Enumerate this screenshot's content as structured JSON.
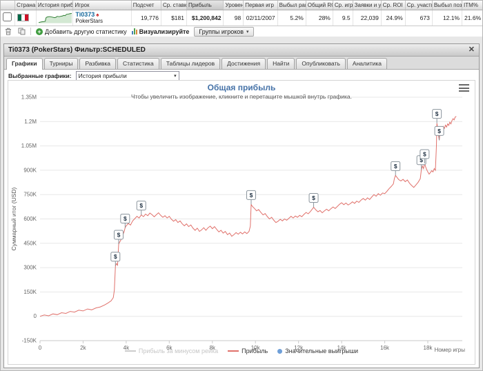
{
  "results_table": {
    "headers": [
      "",
      "Страна",
      "История прибыл",
      "Игрок",
      "Подсчет",
      "Ср. ставк",
      "Прибыль",
      "Уровень",
      "Первая игр",
      "Выбыл ранс",
      "Общий RO",
      "Ср. игр",
      "Заявки и у",
      "Ср. ROI",
      "Ср. участи",
      "Выбыл поздно",
      "ITM%"
    ],
    "row": {
      "country": "Mexico",
      "player": "Ti0373",
      "network": "PokerStars",
      "values": [
        "19,776",
        "$181",
        "$1,200,842",
        "98",
        "02/11/2007",
        "5.2%",
        "28%",
        "9.5",
        "22,039",
        "24.9%",
        "673",
        "12.1%",
        "21.6%"
      ]
    }
  },
  "toolbar": {
    "add_statistic": "Добавить другую статистику",
    "visualize": "Визуализируйте",
    "player_groups": "Группы игроков"
  },
  "panel": {
    "title": "Ti0373 (PokerStars) Фильтр:SCHEDULED",
    "tabs": [
      "Графики",
      "Турниры",
      "Разбивка",
      "Статистика",
      "Таблицы лидеров",
      "Достижения",
      "Найти",
      "Опубликовать",
      "Аналитика"
    ],
    "active_tab": "Графики",
    "selected_graphs_label": "Выбранные графики:",
    "selected_graph": "История прибыли"
  },
  "colors": {
    "accent_blue": "#4572a7",
    "profit_line": "#e0706a",
    "wins_blue": "#6f9fd8",
    "disabled_legend": "#cccccc"
  },
  "chart_data": {
    "type": "line",
    "title": "Общая прибыль",
    "subtitle": "Чтобы увеличить изображение, кликните и перетащите мышкой внутрь графика.",
    "xlabel": "Номер игры",
    "ylabel": "Суммарный итог (USD)",
    "xlim": [
      0,
      19600
    ],
    "ylim": [
      -150000,
      1350000
    ],
    "grid": "horizontal",
    "legend_position": "bottom",
    "flag_label": "$",
    "xticks": {
      "values": [
        0,
        2000,
        4000,
        6000,
        8000,
        10000,
        12000,
        14000,
        16000,
        18000
      ],
      "labels": [
        "0",
        "2k",
        "4k",
        "6k",
        "8k",
        "10k",
        "12k",
        "14k",
        "16k",
        "18k"
      ]
    },
    "yticks": {
      "values": [
        -150000,
        0,
        150000,
        300000,
        450000,
        600000,
        750000,
        900000,
        1050000,
        1200000,
        1350000
      ],
      "labels": [
        "-150K",
        "0",
        "150K",
        "300K",
        "450K",
        "600K",
        "750K",
        "900K",
        "1.05M",
        "1.2M",
        "1.35M"
      ]
    },
    "series": [
      {
        "name": "Прибыль за минусом рейка",
        "color": "#cccccc",
        "visible": false,
        "points": []
      },
      {
        "name": "Прибыль",
        "color": "#e0706a",
        "visible": true,
        "points": [
          [
            0,
            0
          ],
          [
            200,
            8000
          ],
          [
            400,
            3000
          ],
          [
            600,
            15000
          ],
          [
            800,
            10000
          ],
          [
            1000,
            22000
          ],
          [
            1200,
            18000
          ],
          [
            1400,
            30000
          ],
          [
            1600,
            26000
          ],
          [
            1800,
            38000
          ],
          [
            2000,
            33000
          ],
          [
            2200,
            45000
          ],
          [
            2400,
            40000
          ],
          [
            2600,
            52000
          ],
          [
            2800,
            58000
          ],
          [
            3000,
            70000
          ],
          [
            3150,
            82000
          ],
          [
            3300,
            95000
          ],
          [
            3400,
            115000
          ],
          [
            3450,
            160000
          ],
          [
            3500,
            310000
          ],
          [
            3550,
            325000
          ],
          [
            3600,
            315000
          ],
          [
            3650,
            445000
          ],
          [
            3700,
            458000
          ],
          [
            3750,
            470000
          ],
          [
            3800,
            488000
          ],
          [
            3850,
            505000
          ],
          [
            3900,
            520000
          ],
          [
            3950,
            545000
          ],
          [
            4000,
            558000
          ],
          [
            4100,
            572000
          ],
          [
            4200,
            562000
          ],
          [
            4300,
            588000
          ],
          [
            4400,
            602000
          ],
          [
            4500,
            616000
          ],
          [
            4600,
            606000
          ],
          [
            4700,
            625000
          ],
          [
            4800,
            614000
          ],
          [
            4900,
            630000
          ],
          [
            5000,
            620000
          ],
          [
            5100,
            636000
          ],
          [
            5200,
            626000
          ],
          [
            5300,
            613000
          ],
          [
            5400,
            626000
          ],
          [
            5500,
            638000
          ],
          [
            5600,
            622000
          ],
          [
            5700,
            610000
          ],
          [
            5800,
            620000
          ],
          [
            5900,
            606000
          ],
          [
            6000,
            616000
          ],
          [
            6100,
            598000
          ],
          [
            6200,
            586000
          ],
          [
            6300,
            596000
          ],
          [
            6400,
            578000
          ],
          [
            6500,
            588000
          ],
          [
            6600,
            570000
          ],
          [
            6700,
            558000
          ],
          [
            6800,
            570000
          ],
          [
            6900,
            553000
          ],
          [
            7000,
            563000
          ],
          [
            7100,
            543000
          ],
          [
            7200,
            530000
          ],
          [
            7300,
            543000
          ],
          [
            7400,
            523000
          ],
          [
            7500,
            533000
          ],
          [
            7600,
            546000
          ],
          [
            7700,
            530000
          ],
          [
            7800,
            546000
          ],
          [
            7900,
            556000
          ],
          [
            8000,
            540000
          ],
          [
            8100,
            553000
          ],
          [
            8200,
            536000
          ],
          [
            8300,
            520000
          ],
          [
            8400,
            530000
          ],
          [
            8500,
            513000
          ],
          [
            8600,
            523000
          ],
          [
            8700,
            503000
          ],
          [
            8800,
            513000
          ],
          [
            8900,
            493000
          ],
          [
            9000,
            503000
          ],
          [
            9100,
            516000
          ],
          [
            9200,
            506000
          ],
          [
            9300,
            518000
          ],
          [
            9400,
            508000
          ],
          [
            9500,
            520000
          ],
          [
            9600,
            510000
          ],
          [
            9700,
            523000
          ],
          [
            9760,
            555000
          ],
          [
            9800,
            690000
          ],
          [
            9850,
            678000
          ],
          [
            9950,
            665000
          ],
          [
            10050,
            650000
          ],
          [
            10150,
            658000
          ],
          [
            10250,
            640000
          ],
          [
            10350,
            625000
          ],
          [
            10450,
            633000
          ],
          [
            10550,
            615000
          ],
          [
            10650,
            600000
          ],
          [
            10750,
            610000
          ],
          [
            10850,
            592000
          ],
          [
            10950,
            578000
          ],
          [
            11050,
            586000
          ],
          [
            11150,
            598000
          ],
          [
            11250,
            588000
          ],
          [
            11350,
            600000
          ],
          [
            11450,
            592000
          ],
          [
            11550,
            604000
          ],
          [
            11650,
            616000
          ],
          [
            11750,
            606000
          ],
          [
            11850,
            618000
          ],
          [
            11950,
            610000
          ],
          [
            12050,
            622000
          ],
          [
            12150,
            614000
          ],
          [
            12250,
            628000
          ],
          [
            12350,
            640000
          ],
          [
            12450,
            632000
          ],
          [
            12550,
            646000
          ],
          [
            12700,
            672000
          ],
          [
            12800,
            656000
          ],
          [
            12900,
            644000
          ],
          [
            13000,
            652000
          ],
          [
            13100,
            638000
          ],
          [
            13200,
            650000
          ],
          [
            13300,
            660000
          ],
          [
            13400,
            650000
          ],
          [
            13500,
            663000
          ],
          [
            13600,
            674000
          ],
          [
            13700,
            664000
          ],
          [
            13800,
            677000
          ],
          [
            13900,
            690000
          ],
          [
            14000,
            700000
          ],
          [
            14100,
            688000
          ],
          [
            14200,
            698000
          ],
          [
            14300,
            686000
          ],
          [
            14400,
            694000
          ],
          [
            14500,
            706000
          ],
          [
            14600,
            696000
          ],
          [
            14700,
            710000
          ],
          [
            14800,
            702000
          ],
          [
            14900,
            716000
          ],
          [
            15000,
            726000
          ],
          [
            15100,
            716000
          ],
          [
            15200,
            730000
          ],
          [
            15300,
            720000
          ],
          [
            15400,
            736000
          ],
          [
            15500,
            750000
          ],
          [
            15600,
            740000
          ],
          [
            15700,
            756000
          ],
          [
            15800,
            746000
          ],
          [
            15900,
            760000
          ],
          [
            16000,
            756000
          ],
          [
            16100,
            770000
          ],
          [
            16200,
            786000
          ],
          [
            16300,
            800000
          ],
          [
            16400,
            816000
          ],
          [
            16450,
            850000
          ],
          [
            16500,
            868000
          ],
          [
            16570,
            856000
          ],
          [
            16650,
            842000
          ],
          [
            16750,
            834000
          ],
          [
            16850,
            844000
          ],
          [
            16950,
            830000
          ],
          [
            17050,
            840000
          ],
          [
            17150,
            820000
          ],
          [
            17250,
            806000
          ],
          [
            17350,
            794000
          ],
          [
            17450,
            810000
          ],
          [
            17550,
            826000
          ],
          [
            17650,
            848000
          ],
          [
            17700,
            905000
          ],
          [
            17750,
            926000
          ],
          [
            17800,
            910000
          ],
          [
            17850,
            942000
          ],
          [
            17900,
            920000
          ],
          [
            17950,
            903000
          ],
          [
            18000,
            890000
          ],
          [
            18060,
            876000
          ],
          [
            18120,
            886000
          ],
          [
            18180,
            898000
          ],
          [
            18240,
            890000
          ],
          [
            18300,
            910000
          ],
          [
            18350,
            900000
          ],
          [
            18400,
            1050000
          ],
          [
            18420,
            1190000
          ],
          [
            18460,
            1158000
          ],
          [
            18490,
            1120000
          ],
          [
            18530,
            1085000
          ],
          [
            18570,
            1138000
          ],
          [
            18620,
            1160000
          ],
          [
            18670,
            1146000
          ],
          [
            18720,
            1170000
          ],
          [
            18770,
            1158000
          ],
          [
            18820,
            1178000
          ],
          [
            18870,
            1166000
          ],
          [
            18920,
            1186000
          ],
          [
            18970,
            1176000
          ],
          [
            19020,
            1196000
          ],
          [
            19070,
            1186000
          ],
          [
            19120,
            1206000
          ],
          [
            19170,
            1218000
          ],
          [
            19220,
            1210000
          ],
          [
            19270,
            1228000
          ],
          [
            19320,
            1232000
          ]
        ]
      }
    ],
    "significant_wins": {
      "name": "Значительные выигрыши",
      "color": "#6f9fd8",
      "points": [
        [
          3500,
          310000
        ],
        [
          3650,
          445000
        ],
        [
          3950,
          545000
        ],
        [
          4700,
          625000
        ],
        [
          9800,
          690000
        ],
        [
          12700,
          672000
        ],
        [
          16500,
          868000
        ],
        [
          17700,
          905000
        ],
        [
          17850,
          942000
        ],
        [
          18420,
          1190000
        ],
        [
          18530,
          1085000
        ]
      ]
    }
  }
}
